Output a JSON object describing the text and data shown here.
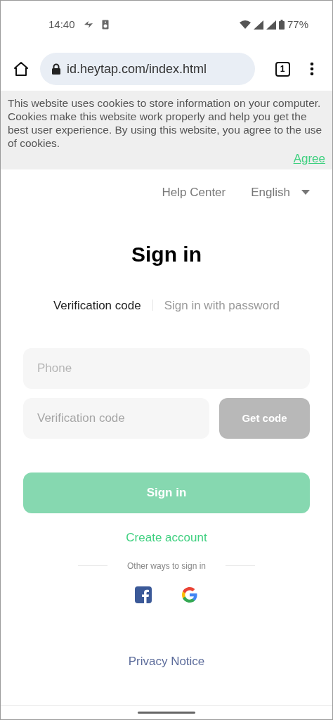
{
  "status_bar": {
    "time": "14:40",
    "battery": "77%"
  },
  "browser": {
    "url": "id.heytap.com/index.html",
    "tab_count": "1"
  },
  "cookie_banner": {
    "text": "This website uses cookies to store information on your computer. Cookies make this website work properly and help you get the best user experience. By using this website, you agree to the use of cookies.",
    "agree": "Agree"
  },
  "header": {
    "help": "Help Center",
    "language": "English"
  },
  "title": "Sign in",
  "tabs": [
    {
      "label": "Verification code",
      "selected": true
    },
    {
      "label": "Sign in with password",
      "selected": false
    }
  ],
  "phone": {
    "placeholder": "Phone"
  },
  "code": {
    "placeholder": "Verification code"
  },
  "get_code": {
    "label": "Get code",
    "disabled": true
  },
  "sign_in": {
    "label": "Sign in",
    "disabled": true
  },
  "create_account": "Create account",
  "other_ways": "Other ways to sign in",
  "privacy": "Privacy Notice"
}
